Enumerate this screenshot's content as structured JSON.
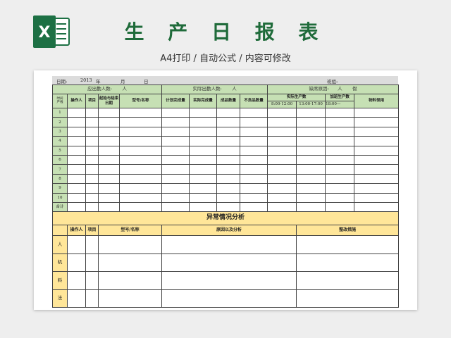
{
  "header": {
    "title": "生 产 日 报 表",
    "subtitle": "A4打印 / 自动公式 / 内容可修改",
    "logo_letter": "X"
  },
  "colors": {
    "brand_green": "#1f6b3a",
    "excel_green": "#1d7044",
    "header_green": "#c6e0b4",
    "section_yellow": "#ffe699"
  },
  "sheet": {
    "date_label": "日期:",
    "year": "2013",
    "year_unit": "年",
    "month_unit": "月",
    "day_unit": "日",
    "team_label": "班组:",
    "expected_label": "应出勤人数:",
    "expected_unit": "人",
    "actual_label": "实际出勤人数:",
    "actual_unit": "人",
    "absence_label": "缺席原因:",
    "absence_value": "人",
    "absence_note": "假",
    "col_corner_top": "时间",
    "col_corner_bottom": "产线",
    "col_operator": "操作人",
    "col_item": "项目",
    "col_start_end": "起始与结束日期",
    "col_model": "型号/名称",
    "col_plan": "计划完成量",
    "col_actual": "实际完成量",
    "col_finished": "成品数量",
    "col_defect": "不良品数量",
    "col_actual_prod": "实际生产数",
    "col_overtime": "加班生产数",
    "col_materials": "物料领用",
    "time_1": "8:00-12:00",
    "time_2": "13:00-17:00",
    "time_3": "18:00—",
    "rows": [
      "1",
      "2",
      "3",
      "4",
      "5",
      "6",
      "7",
      "8",
      "9",
      "10"
    ],
    "total_label": "合计",
    "section_title": "异常情况分析",
    "sec_operator": "操作人",
    "sec_item": "项目",
    "sec_model": "型号/名称",
    "sec_reason": "原因以及分析",
    "sec_measure": "整改措施",
    "factors": [
      "人",
      "机",
      "料",
      "法"
    ]
  }
}
